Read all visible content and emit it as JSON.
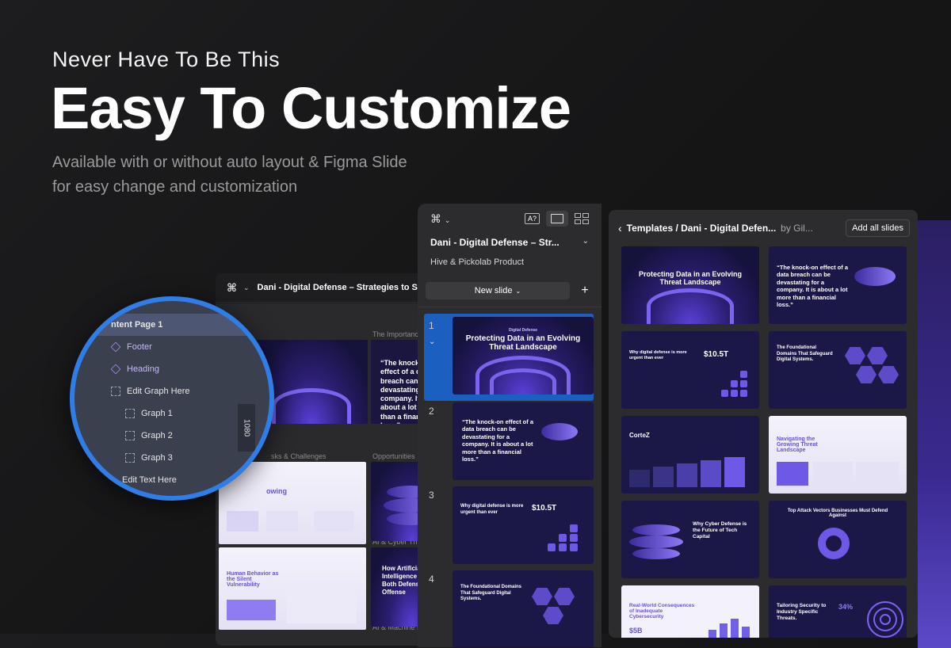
{
  "hero": {
    "subtitle": "Never Have To Be This",
    "title": "Easy To Customize",
    "desc_line1": "Available with or without auto layout  & Figma Slide",
    "desc_line2": "for easy change and customization"
  },
  "back_window": {
    "file_title": "Dani - Digital Defense – Strategies to Secure",
    "size_label": "1080",
    "frame_labels": [
      "The Importance",
      "sks & Challenges",
      "Opportunities",
      "AI & Cyber Th",
      "AI & Machine Lo"
    ]
  },
  "layers": {
    "items": [
      "ntent Page 1",
      "Footer",
      "Heading",
      "Edit Graph Here",
      "Graph 1",
      "Graph 2",
      "Graph 3",
      "Edit Text Here"
    ]
  },
  "slides_panel": {
    "file_title": "Dani - Digital Defense – Str...",
    "org": "Hive & Pickolab Product",
    "new_slide": "New slide",
    "numbers": [
      "1",
      "2",
      "3",
      "4"
    ]
  },
  "templates": {
    "breadcrumb": "Templates / Dani - Digital Defen...",
    "by": "by Gil...",
    "add_all": "Add all slides"
  },
  "slide_text": {
    "s1_title": "Protecting Data in an Evolving Threat Landscape",
    "s1_kicker": "Digital Defense",
    "s2_quote": "“The knock-on effect of a data breach can be devastating for a company. It is about a lot more than a financial loss.”",
    "s3_title": "Why digital defense is more urgent than ever",
    "s3_value": "$10.5T",
    "s4_title": "The Foundational Domains That Safeguard Digital Systems.",
    "t5_brand": "CorteZ",
    "t6_title": "Navigating the Growing Threat Landscape",
    "t7_title": "Why Cyber Defense is the Future of Tech Capital",
    "t8_title": "Top Attack Vectors Businesses Must Defend Against",
    "t9_title": "Real-World Consequences of Inadequate Cybersecurity",
    "t9_value": "$5B",
    "t10_title": "Tailoring Security to Industry Specific Threats.",
    "t10_value": "34%",
    "b_human": "Human Behavior as the Silent Vulnerability",
    "b_ai": "How Artificial Intelligence Fuels Both Defense and Offense",
    "b_growing": "owing"
  },
  "colors": {
    "accent_blue": "#2f7de6",
    "selection_blue": "#1b5fc0",
    "violet": "#6d59e6"
  }
}
